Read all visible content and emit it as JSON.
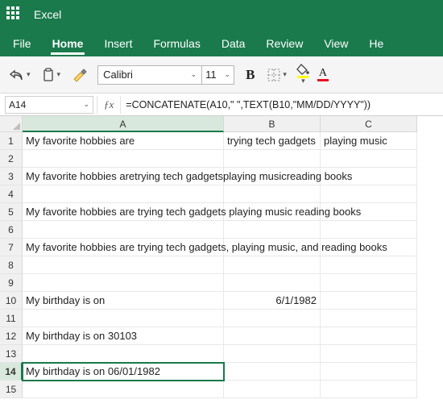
{
  "app": {
    "title": "Excel"
  },
  "ribbon": {
    "tabs": [
      "File",
      "Home",
      "Insert",
      "Formulas",
      "Data",
      "Review",
      "View",
      "He"
    ],
    "active": "Home"
  },
  "toolbar": {
    "font_name": "Calibri",
    "font_size": "11"
  },
  "formula_bar": {
    "name_box": "A14",
    "formula": "=CONCATENATE(A10,\" \",TEXT(B10,\"MM/DD/YYYY\"))"
  },
  "columns": [
    "A",
    "B",
    "C"
  ],
  "rows": [
    {
      "n": "1",
      "A": "My favorite hobbies are",
      "B": "trying tech gadgets",
      "C": "playing music"
    },
    {
      "n": "2",
      "A": "",
      "B": "",
      "C": ""
    },
    {
      "n": "3",
      "A": "My favorite hobbies aretrying tech gadgetsplaying musicreading books",
      "B": "",
      "C": ""
    },
    {
      "n": "4",
      "A": "",
      "B": "",
      "C": ""
    },
    {
      "n": "5",
      "A": "My favorite hobbies are trying tech gadgets playing music reading books",
      "B": "",
      "C": ""
    },
    {
      "n": "6",
      "A": "",
      "B": "",
      "C": ""
    },
    {
      "n": "7",
      "A": "My favorite hobbies are trying tech gadgets, playing music, and reading books",
      "B": "",
      "C": ""
    },
    {
      "n": "8",
      "A": "",
      "B": "",
      "C": ""
    },
    {
      "n": "9",
      "A": "",
      "B": "",
      "C": ""
    },
    {
      "n": "10",
      "A": "My birthday is on",
      "B": "6/1/1982",
      "C": ""
    },
    {
      "n": "11",
      "A": "",
      "B": "",
      "C": ""
    },
    {
      "n": "12",
      "A": "My birthday is on 30103",
      "B": "",
      "C": ""
    },
    {
      "n": "13",
      "A": "",
      "B": "",
      "C": ""
    },
    {
      "n": "14",
      "A": "My birthday is on 06/01/1982",
      "B": "",
      "C": ""
    },
    {
      "n": "15",
      "A": "",
      "B": "",
      "C": ""
    }
  ],
  "selected": {
    "row": "14",
    "col": "A"
  }
}
